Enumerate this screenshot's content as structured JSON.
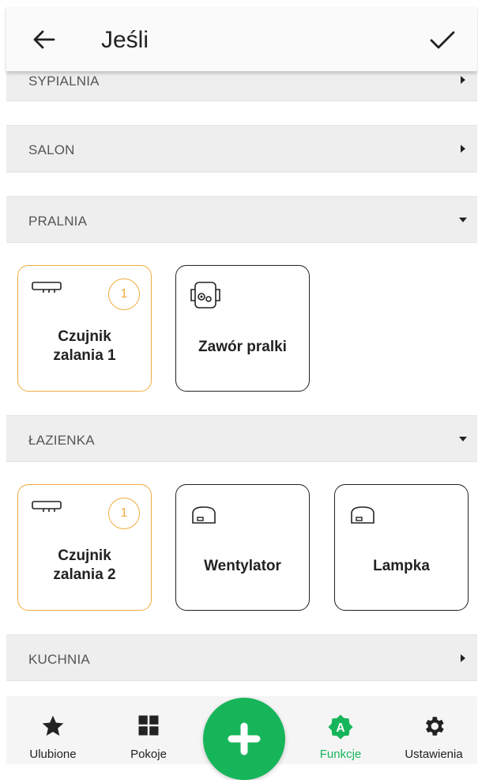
{
  "header": {
    "title": "Jeśli",
    "back_icon": "arrow-left-icon",
    "confirm_icon": "check-icon"
  },
  "rooms": [
    {
      "name": "SYPIALNIA",
      "expanded": false
    },
    {
      "name": "SALON",
      "expanded": false
    },
    {
      "name": "PRALNIA",
      "expanded": true
    },
    {
      "name": "ŁAZIENKA",
      "expanded": true
    },
    {
      "name": "KUCHNIA",
      "expanded": false
    }
  ],
  "devices": {
    "pralnia": [
      {
        "name_line1": "Czujnik",
        "name_line2": "zalania 1",
        "badge": "1",
        "selected": true,
        "icon": "flood-sensor-icon"
      },
      {
        "name": "Zawór pralki",
        "selected": false,
        "icon": "valve-icon"
      }
    ],
    "lazienka": [
      {
        "name_line1": "Czujnik",
        "name_line2": "zalania 2",
        "badge": "1",
        "selected": true,
        "icon": "flood-sensor-icon"
      },
      {
        "name": "Wentylator",
        "selected": false,
        "icon": "relay-icon"
      },
      {
        "name": "Lampka",
        "selected": false,
        "icon": "relay-icon"
      }
    ]
  },
  "bottom_nav": {
    "items": [
      {
        "label": "Ulubione",
        "icon": "star-icon"
      },
      {
        "label": "Pokoje",
        "icon": "grid-icon"
      },
      {
        "label": "Funkcje",
        "icon": "functions-icon",
        "active": true
      },
      {
        "label": "Ustawienia",
        "icon": "gear-icon"
      }
    ],
    "fab_icon": "plus-icon"
  },
  "colors": {
    "accent": "#17b55a",
    "selected_border": "#f0ac3e",
    "room_bar": "#eeeeee"
  }
}
